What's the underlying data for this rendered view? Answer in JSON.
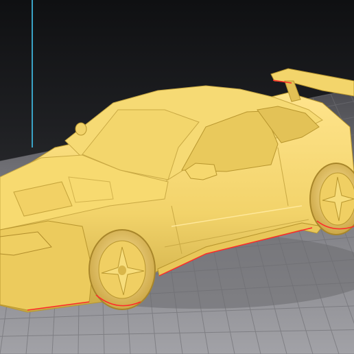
{
  "viewport": {
    "background_top": "#0f1012",
    "background_bottom": "#8b8b90",
    "plate_color": "#9a9a9e",
    "grid_line_color": "#6f6f74",
    "axis_color": "#3aa3c6"
  },
  "model": {
    "body_color": "#f2d36a",
    "body_shadow_color": "#c9a944",
    "body_highlight_color": "#ffe48c",
    "overhang_color": "#ff2a2a"
  }
}
